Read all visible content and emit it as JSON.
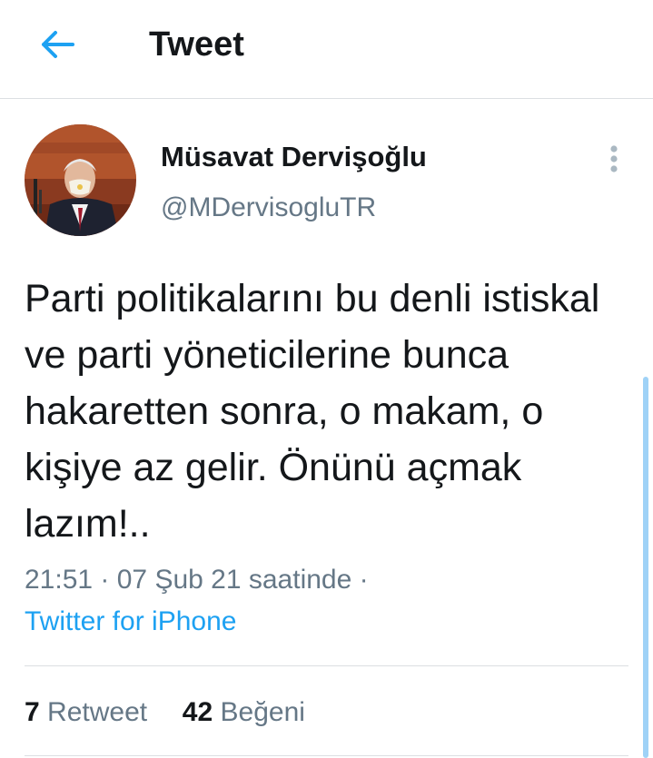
{
  "header": {
    "back_icon": "arrow-left-icon",
    "title": "Tweet"
  },
  "tweet": {
    "author_name": "Müsavat Dervişoğlu",
    "author_handle": "@MDervisogluTR",
    "more_icon": "vertical-dots-icon",
    "text": "Parti politikalarını bu denli istiskal ve parti yöneticilerine bunca hakaretten sonra, o makam, o kişiye az gelir. Önünü açmak lazım!..",
    "time": "21:51",
    "date": "07 Şub 21 saatinde",
    "source": "Twitter for iPhone",
    "retweet_count": "7",
    "retweet_label": "Retweet",
    "like_count": "42",
    "like_label": "Beğeni"
  },
  "colors": {
    "accent": "#1da1f2",
    "secondary_text": "#657786",
    "divider": "#dcdfe2"
  }
}
